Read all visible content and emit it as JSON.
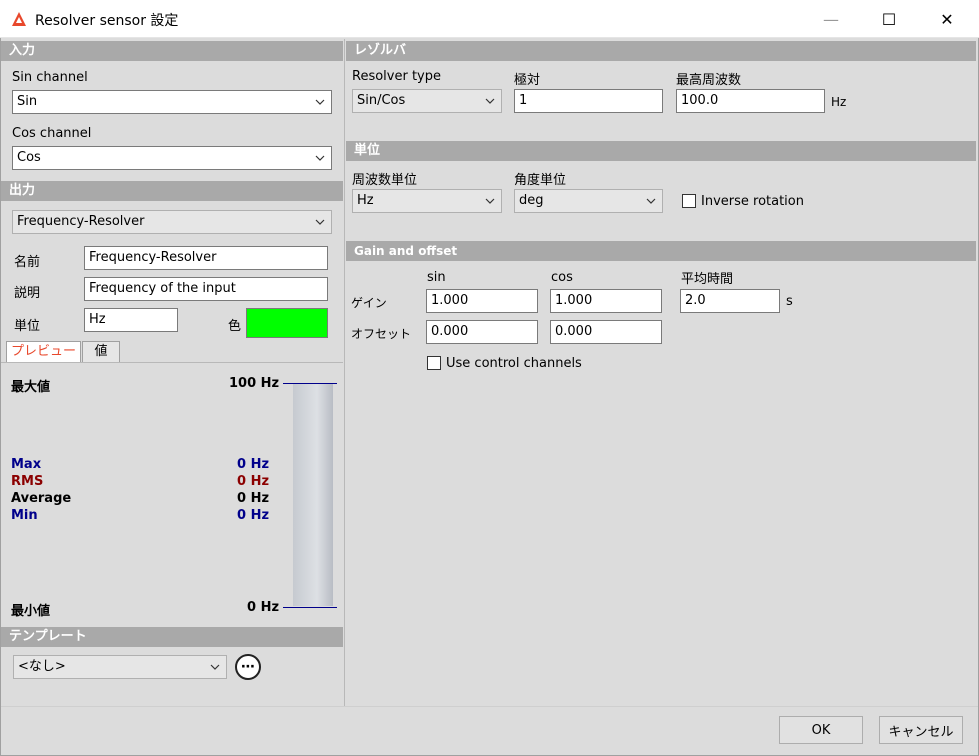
{
  "window": {
    "title": "Resolver sensor 設定",
    "minimize_symbol": "—",
    "maximize_symbol": "☐",
    "close_symbol": "✕",
    "app_icon": "triangle-logo-icon"
  },
  "input": {
    "header": "入力",
    "sin_label": "Sin channel",
    "sin_value": "Sin",
    "cos_label": "Cos channel",
    "cos_value": "Cos"
  },
  "output": {
    "header": "出力",
    "selected": "Frequency-Resolver",
    "name_label": "名前",
    "name_value": "Frequency-Resolver",
    "desc_label": "説明",
    "desc_value": "Frequency of the input",
    "unit_label": "単位",
    "unit_value": "Hz",
    "color_label": "色",
    "color_value": "#00ff00"
  },
  "tabs": [
    {
      "label": "プレビュー"
    },
    {
      "label": "値"
    }
  ],
  "preview": {
    "max_label": "最大値",
    "max_value": "100 Hz",
    "min_label": "最小値",
    "min_value": "0 Hz",
    "stats": [
      {
        "label": "Max",
        "value": "0 Hz",
        "color": "#00008b"
      },
      {
        "label": "RMS",
        "value": "0 Hz",
        "color": "#8b0000"
      },
      {
        "label": "Average",
        "value": "0 Hz",
        "color": "#000000"
      },
      {
        "label": "Min",
        "value": "0 Hz",
        "color": "#00008b"
      }
    ]
  },
  "template": {
    "header": "テンプレート",
    "value": "<なし>",
    "more_symbol": "⋯"
  },
  "resolver": {
    "header": "レゾルバ",
    "type_label": "Resolver type",
    "type_value": "Sin/Cos",
    "poles_label": "極対",
    "poles_value": "1",
    "maxfreq_label": "最高周波数",
    "maxfreq_value": "100.0",
    "maxfreq_unit": "Hz"
  },
  "units": {
    "header": "単位",
    "freq_label": "周波数単位",
    "freq_value": "Hz",
    "angle_label": "角度単位",
    "angle_value": "deg",
    "inverse_label": "Inverse rotation"
  },
  "gain_offset": {
    "header": "Gain and offset",
    "sin_col": "sin",
    "cos_col": "cos",
    "avg_label": "平均時間",
    "gain_label": "ゲイン",
    "gain_sin": "1.000",
    "gain_cos": "1.000",
    "avg_value": "2.0",
    "avg_unit": "s",
    "offset_label": "オフセット",
    "offset_sin": "0.000",
    "offset_cos": "0.000",
    "control_label": "Use control channels"
  },
  "buttons": {
    "ok": "OK",
    "cancel": "キャンセル"
  }
}
